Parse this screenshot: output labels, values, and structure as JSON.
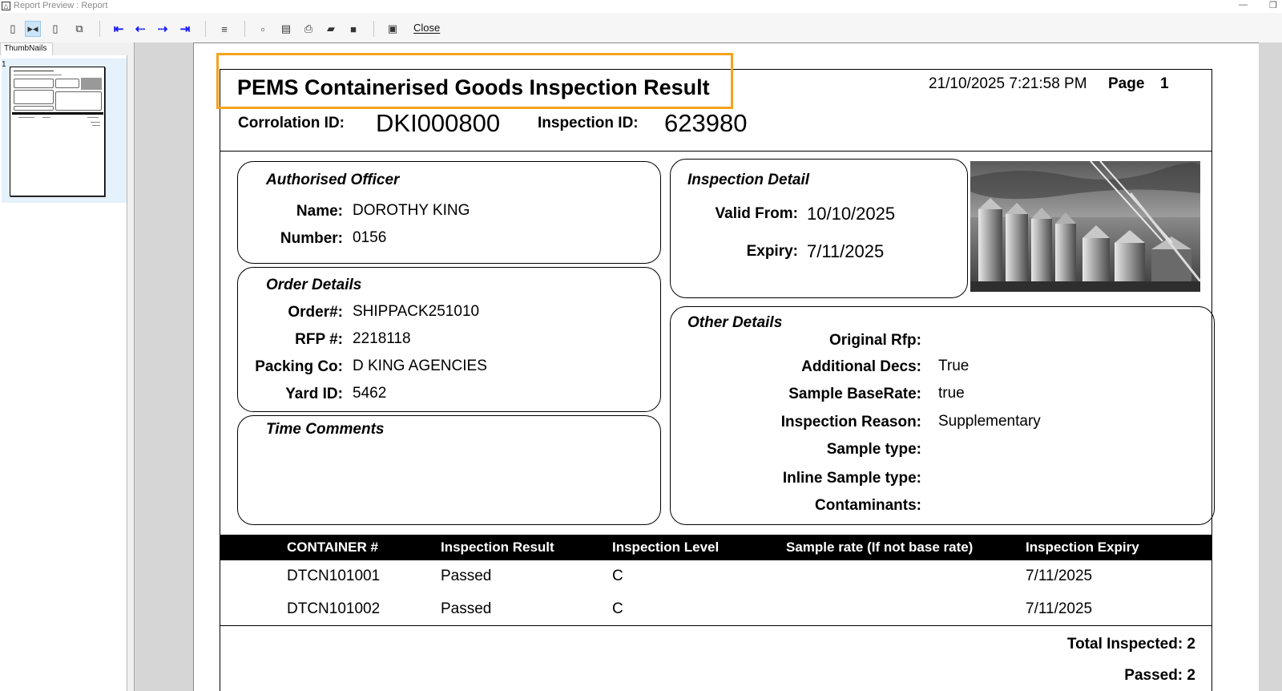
{
  "window": {
    "title": "Report Preview : Report",
    "minimize_glyph": "—",
    "restore_glyph": "❐"
  },
  "toolbar": {
    "close_label": "Close",
    "icons": [
      "page-icon",
      "two-page-icon",
      "single-page-icon",
      "copy-icon",
      "first-page-icon",
      "prev-page-icon",
      "next-page-icon",
      "last-page-icon",
      "go-to-page-icon",
      "new-icon",
      "setup-icon",
      "print-icon",
      "open-icon",
      "save-icon",
      "help-icon"
    ]
  },
  "thumbnails": {
    "tab_label": "ThumbNails",
    "page_number": "1"
  },
  "report": {
    "title": "PEMS Containerised Goods Inspection Result",
    "datetime": "21/10/2025 7:21:58 PM",
    "page_label": "Page",
    "page_number": "1",
    "correlation_label": "Corrolation ID:",
    "correlation_value": "DKI000800",
    "inspection_id_label": "Inspection ID:",
    "inspection_id_value": "623980",
    "authorised_officer": {
      "title": "Authorised Officer",
      "name_label": "Name:",
      "name_value": "DOROTHY KING",
      "number_label": "Number:",
      "number_value": "0156"
    },
    "inspection_detail": {
      "title": "Inspection Detail",
      "valid_from_label": "Valid From:",
      "valid_from_value": "10/10/2025",
      "expiry_label": "Expiry:",
      "expiry_value": "7/11/2025"
    },
    "order_details": {
      "title": "Order Details",
      "order_label": "Order#:",
      "order_value": "SHIPPACK251010",
      "rfp_label": "RFP #:",
      "rfp_value": "2218118",
      "packing_label": "Packing Co:",
      "packing_value": "D KING AGENCIES",
      "yard_label": "Yard ID:",
      "yard_value": "5462"
    },
    "time_comments": {
      "title": "Time Comments"
    },
    "other_details": {
      "title": "Other Details",
      "original_rfp_label": "Original Rfp:",
      "additional_decs_label": "Additional Decs:",
      "additional_decs_value": "True",
      "sample_baserate_label": "Sample BaseRate:",
      "sample_baserate_value": "true",
      "inspection_reason_label": "Inspection Reason:",
      "inspection_reason_value": "Supplementary",
      "sample_type_label": "Sample type:",
      "inline_sample_type_label": "Inline Sample type:",
      "contaminants_label": "Contaminants:"
    },
    "table": {
      "headers": [
        "CONTAINER #",
        "Inspection Result",
        "Inspection Level",
        "Sample rate (If not base rate)",
        "Inspection Expiry"
      ],
      "rows": [
        [
          "DTCN101001",
          "Passed",
          "C",
          "",
          "7/11/2025"
        ],
        [
          "DTCN101002",
          "Passed",
          "C",
          "",
          "7/11/2025"
        ]
      ]
    },
    "totals": {
      "total_inspected": "Total Inspected: 2",
      "passed": "Passed: 2"
    }
  },
  "colors": {
    "highlight": "#f5a21b",
    "toolbar_nav": "#1a1aff",
    "table_header_bg": "#000000"
  }
}
